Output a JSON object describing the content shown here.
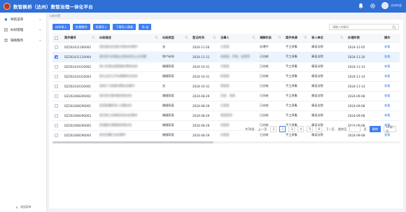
{
  "header": {
    "title": "数智枫桥（达州）数智治理一体化平台",
    "user_name": "达州市县",
    "icons": [
      "bell-icon",
      "gear-icon",
      "avatar"
    ]
  },
  "sidebar": {
    "items": [
      {
        "label": "导航菜单",
        "icon": "home-icon"
      },
      {
        "label": "纠纷管理",
        "icon": "list-icon"
      },
      {
        "label": "辅助服务",
        "icon": "grid-icon"
      }
    ],
    "collapse_label": "收起菜单"
  },
  "breadcrumb": "纠纷处置",
  "toolbar": {
    "buttons": [
      "纠纷录入",
      "批量删除",
      "批量导入",
      "下载导入模板",
      "导 出"
    ]
  },
  "search": {
    "placeholder": "请输入关键词"
  },
  "table": {
    "columns": [
      "",
      "案件编号",
      "纠纷描述",
      "纠纷类型",
      "登记时间",
      "当事人",
      "调解状态",
      "案件来源",
      "录入单位",
      "办理时限",
      "操作"
    ],
    "rows": [
      {
        "checked": false,
        "selected": false,
        "id": "DZ202411260002",
        "desc": "某街道社区居民邻里纠纷事件",
        "type": "无",
        "date": "2024-11-26",
        "party": "王某某",
        "status": "办理中",
        "source": "手工采集",
        "unit": "康县法院",
        "deadline": "2024-12-05",
        "op": "查看"
      },
      {
        "checked": true,
        "selected": true,
        "id": "DZ202411110004",
        "desc": "某村民与村委会土地纠纷及上访问题",
        "type": "财产纠纷",
        "date": "2024-11-11",
        "party": "张某某、李某、赵某等",
        "status": "已办结",
        "source": "手工采集",
        "unit": "康县法院",
        "deadline": "2024-11-20",
        "op": "查看"
      },
      {
        "checked": false,
        "selected": false,
        "id": "DZ202410310002",
        "desc": "某小区物业管理服务费用纠纷",
        "type": "婚姻家庭",
        "date": "2024-10-31",
        "party": "刘某某",
        "status": "已办结",
        "source": "手工采集",
        "unit": "康县法院",
        "deadline": "2024-11-14",
        "op": "查看"
      },
      {
        "checked": false,
        "selected": false,
        "id": "DZ202410310003",
        "desc": "某企业员工劳动报酬争议纠纷",
        "type": "婚姻家庭",
        "date": "2024-10-31",
        "party": "陈某某",
        "status": "已办结",
        "source": "手工采集",
        "unit": "康县法院",
        "deadline": "2024-11-14",
        "op": "查看"
      },
      {
        "checked": false,
        "selected": false,
        "id": "DZ202410310001",
        "desc": "某商户与顾客消费纠纷事件",
        "type": "无",
        "date": "2024-10-31",
        "party": "周某某",
        "status": "已办结",
        "source": "手工采集",
        "unit": "康县法院",
        "deadline": "2024-11-14",
        "op": "查看"
      },
      {
        "checked": false,
        "selected": false,
        "id": "DZ202408290002",
        "desc": "某村民宅基地使用权纠纷",
        "type": "婚姻家庭",
        "date": "2024-08-29",
        "party": "吴某、郑某",
        "status": "已办结",
        "source": "手工采集",
        "unit": "康县法院",
        "deadline": "2024-09-08",
        "op": "查看"
      },
      {
        "checked": false,
        "selected": false,
        "id": "DZ202408290001",
        "desc": "某家庭赡养老人问题纠纷",
        "type": "婚姻家庭",
        "date": "2024-08-29",
        "party": "孙某某",
        "status": "已办结",
        "source": "手工采集",
        "unit": "康县法院",
        "deadline": "2024-09-08",
        "op": "查看"
      },
      {
        "checked": false,
        "selected": false,
        "id": "DZ202408290003",
        "desc": "某邻里之间噪音扰民纠纷事件",
        "type": "婚姻家庭",
        "date": "2024-08-29",
        "party": "黄某某等",
        "status": "已办结",
        "source": "手工采集",
        "unit": "康县法院",
        "deadline": "2024-09-08",
        "op": "查看"
      },
      {
        "checked": false,
        "selected": false,
        "id": "DZ202408290005",
        "desc": "某道路交通事故赔偿纠纷",
        "type": "婚姻家庭",
        "date": "2024-08-29",
        "party": "林某某",
        "status": "已办结",
        "source": "手工采集",
        "unit": "康县法院",
        "deadline": "2024-09-08",
        "op": "查看"
      },
      {
        "checked": false,
        "selected": false,
        "id": "DZ202408290004",
        "desc": "某合同履行纠纷事件",
        "type": "婚姻家庭",
        "date": "2024-08-29",
        "party": "何某某",
        "status": "已办结",
        "source": "手工采集",
        "unit": "康县法院",
        "deadline": "2024-09-08",
        "op": "查看"
      }
    ]
  },
  "pagination": {
    "total_label": "共58条",
    "prev_label": "上一页",
    "pages": [
      "1",
      "2",
      "3",
      "4",
      "5",
      "6"
    ],
    "current_page": "2",
    "next_label": "下一页",
    "jump_label": "跳转至",
    "page_unit": "页",
    "go_label": "跳转",
    "size_label": "10条/页"
  }
}
